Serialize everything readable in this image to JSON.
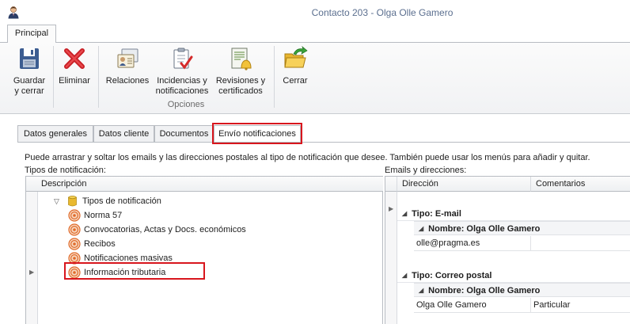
{
  "window": {
    "title": "Contacto 203 - Olga Olle Gamero",
    "icon": "user-avatar-icon"
  },
  "ribbon": {
    "tab_label": "Principal",
    "buttons": [
      {
        "label1": "Guardar",
        "label2": "y cerrar",
        "icon": "save-floppy-icon"
      },
      {
        "label1": "Eliminar",
        "label2": "",
        "icon": "delete-x-icon"
      },
      {
        "label1": "Relaciones",
        "label2": "",
        "icon": "relations-cards-icon"
      },
      {
        "label1": "Incidencias y",
        "label2": "notificaciones",
        "icon": "checklist-clipboard-icon"
      },
      {
        "label1": "Revisiones y",
        "label2": "certificados",
        "icon": "bell-document-icon"
      },
      {
        "label1": "Cerrar",
        "label2": "",
        "icon": "folder-arrow-icon"
      }
    ],
    "group_label": "Opciones"
  },
  "tabs": [
    "Datos generales",
    "Datos cliente",
    "Documentos",
    "Envío notificaciones"
  ],
  "active_tab_index": 3,
  "info_text": "Puede arrastrar y soltar los emails y las direcciones postales al tipo de notificación que desee. También puede usar los menús para añadir y quitar.",
  "left_panel": {
    "label": "Tipos de notificación:",
    "column_header": "Descripción",
    "root": "Tipos de notificación",
    "items": [
      "Norma 57",
      "Convocatorias, Actas y Docs. económicos",
      "Recibos",
      "Notificaciones masivas",
      "Información tributaria"
    ],
    "selected_index": 4
  },
  "right_panel": {
    "label": "Emails y direcciones:",
    "columns": [
      "Dirección",
      "Comentarios"
    ],
    "groups": [
      {
        "title": "Tipo: E-mail",
        "subtitle": "Nombre: Olga Olle Gamero",
        "rows": [
          {
            "direccion": "olle@pragma.es",
            "comentarios": ""
          }
        ]
      },
      {
        "title": "Tipo: Correo postal",
        "subtitle": "Nombre: Olga Olle Gamero",
        "rows": [
          {
            "direccion": "Olga Olle Gamero",
            "comentarios": "Particular"
          }
        ]
      }
    ]
  },
  "colors": {
    "highlight": "#d8161d",
    "title": "#5b6f8f",
    "border": "#b8bcc2"
  }
}
